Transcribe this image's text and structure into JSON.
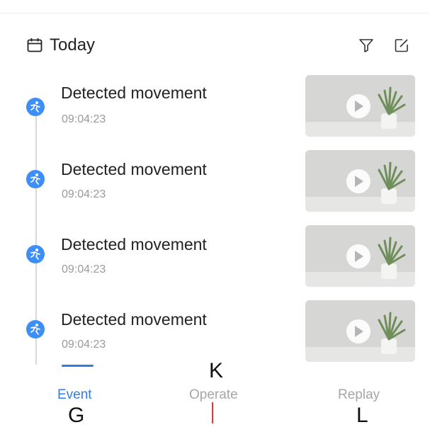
{
  "header": {
    "title": "Today"
  },
  "events": [
    {
      "title": "Detected movement",
      "time": "09:04:23"
    },
    {
      "title": "Detected movement",
      "time": "09:04:23"
    },
    {
      "title": "Detected movement",
      "time": "09:04:23"
    },
    {
      "title": "Detected movement",
      "time": "09:04:23"
    }
  ],
  "tabs": {
    "event": "Event",
    "operate": "Operate",
    "replay": "Replay"
  },
  "markers": {
    "g": "G",
    "k": "K",
    "l": "L"
  },
  "colors": {
    "accent": "#2f7de1",
    "event_dot": "#3d8ef7",
    "inactive_tab": "#a6a6a6"
  }
}
